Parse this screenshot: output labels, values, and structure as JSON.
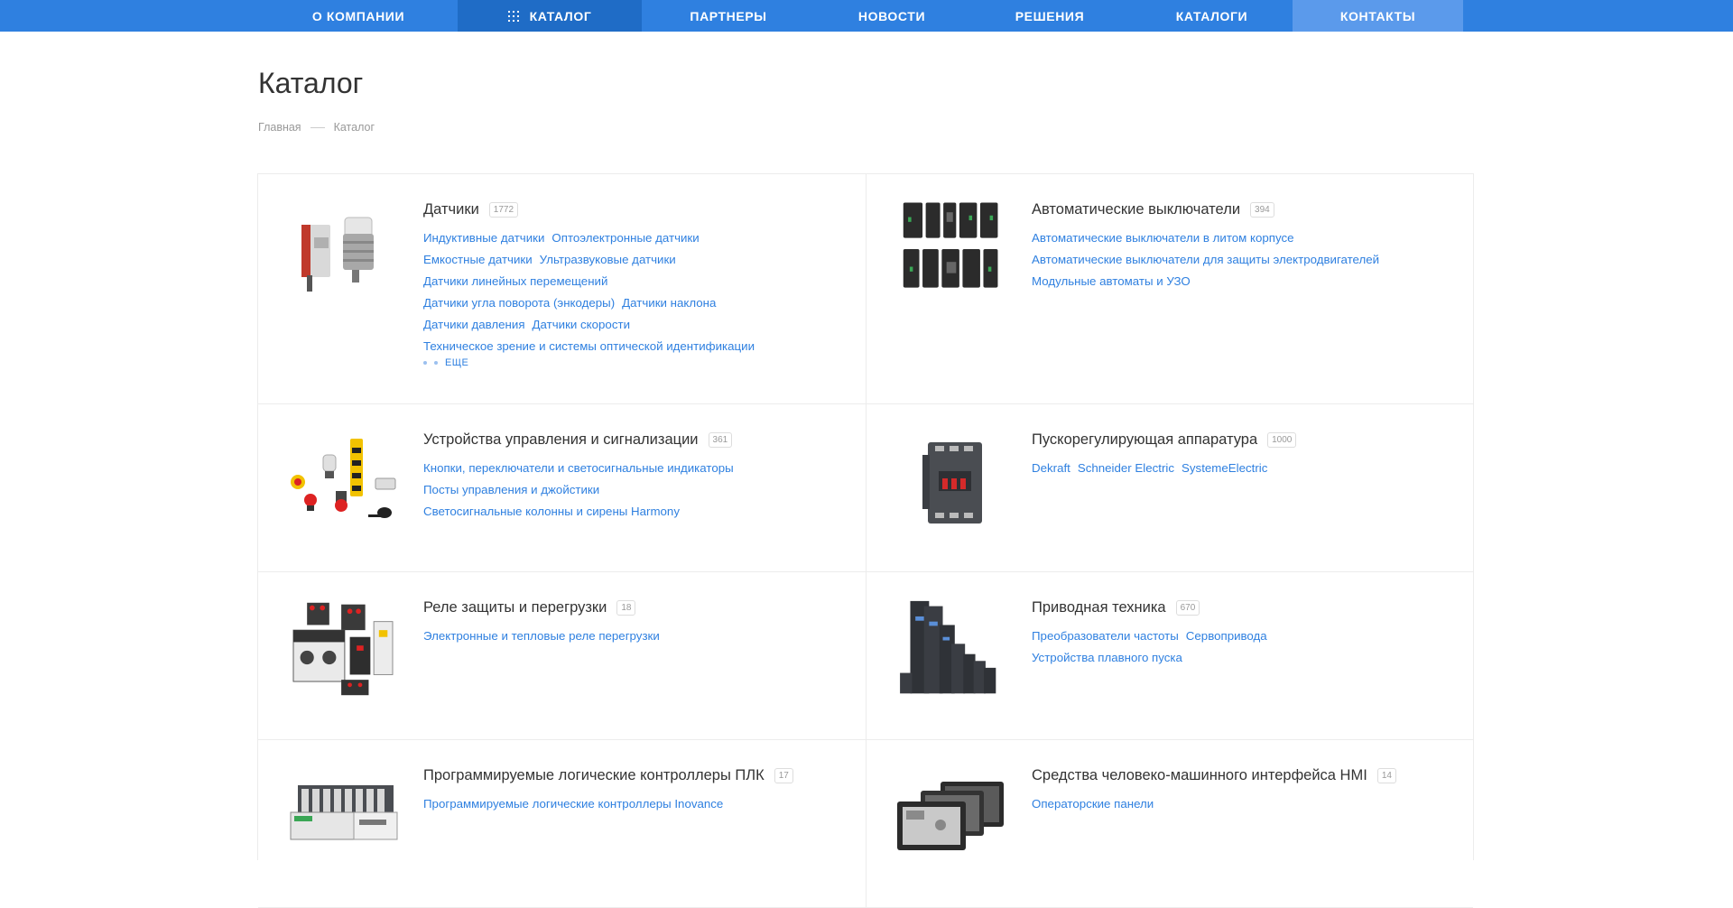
{
  "nav": {
    "items": [
      {
        "label": "О КОМПАНИИ"
      },
      {
        "label": "КАТАЛОГ"
      },
      {
        "label": "ПАРТНЕРЫ"
      },
      {
        "label": "НОВОСТИ"
      },
      {
        "label": "РЕШЕНИЯ"
      },
      {
        "label": "КАТАЛОГИ"
      },
      {
        "label": "КОНТАКТЫ"
      }
    ]
  },
  "page": {
    "title": "Каталог",
    "breadcrumb": [
      "Главная",
      "Каталог"
    ]
  },
  "catalog": [
    {
      "title": "Датчики",
      "count": "1772",
      "thumb_icon": "sensors-image",
      "links": [
        [
          "Индуктивные датчики",
          "Оптоэлектронные датчики"
        ],
        [
          "Емкостные датчики",
          "Ультразвуковые датчики"
        ],
        [
          "Датчики линейных перемещений"
        ],
        [
          "Датчики угла поворота (энкодеры)",
          "Датчики наклона"
        ],
        [
          "Датчики давления",
          "Датчики скорости"
        ],
        [
          "Техническое зрение и системы оптической идентификации"
        ]
      ],
      "more": "ЕЩЕ"
    },
    {
      "title": "Автоматические выключатели",
      "count": "394",
      "thumb_icon": "circuit-breakers-image",
      "links": [
        [
          "Автоматические выключатели в литом корпусе"
        ],
        [
          "Автоматические выключатели для защиты электродвигателей"
        ],
        [
          "Модульные автоматы и УЗО"
        ]
      ]
    },
    {
      "title": "Устройства управления и сигнализации",
      "count": "361",
      "thumb_icon": "control-devices-image",
      "links": [
        [
          "Кнопки, переключатели и светосигнальные индикаторы"
        ],
        [
          "Посты управления и джойстики"
        ],
        [
          "Светосигнальные колонны и сирены Harmony"
        ]
      ]
    },
    {
      "title": "Пускорегулирующая аппаратура",
      "count": "1000",
      "thumb_icon": "contactor-image",
      "links": [
        [
          "Dekraft",
          "Schneider Electric",
          "SystemeElectric"
        ]
      ]
    },
    {
      "title": "Реле защиты и перегрузки",
      "count": "18",
      "thumb_icon": "relays-image",
      "links": [
        [
          "Электронные и тепловые реле перегрузки"
        ]
      ]
    },
    {
      "title": "Приводная техника",
      "count": "670",
      "thumb_icon": "drives-image",
      "links": [
        [
          "Преобразователи частоты",
          "Сервопривода"
        ],
        [
          "Устройства плавного пуска"
        ]
      ]
    },
    {
      "title": "Программируемые логические контроллеры ПЛК",
      "count": "17",
      "thumb_icon": "plc-image",
      "links": [
        [
          "Программируемые логические контроллеры Inovance"
        ]
      ]
    },
    {
      "title": "Средства человеко-машинного интерфейса HMI",
      "count": "14",
      "thumb_icon": "hmi-panels-image",
      "links": [
        [
          "Операторские панели"
        ]
      ]
    }
  ]
}
